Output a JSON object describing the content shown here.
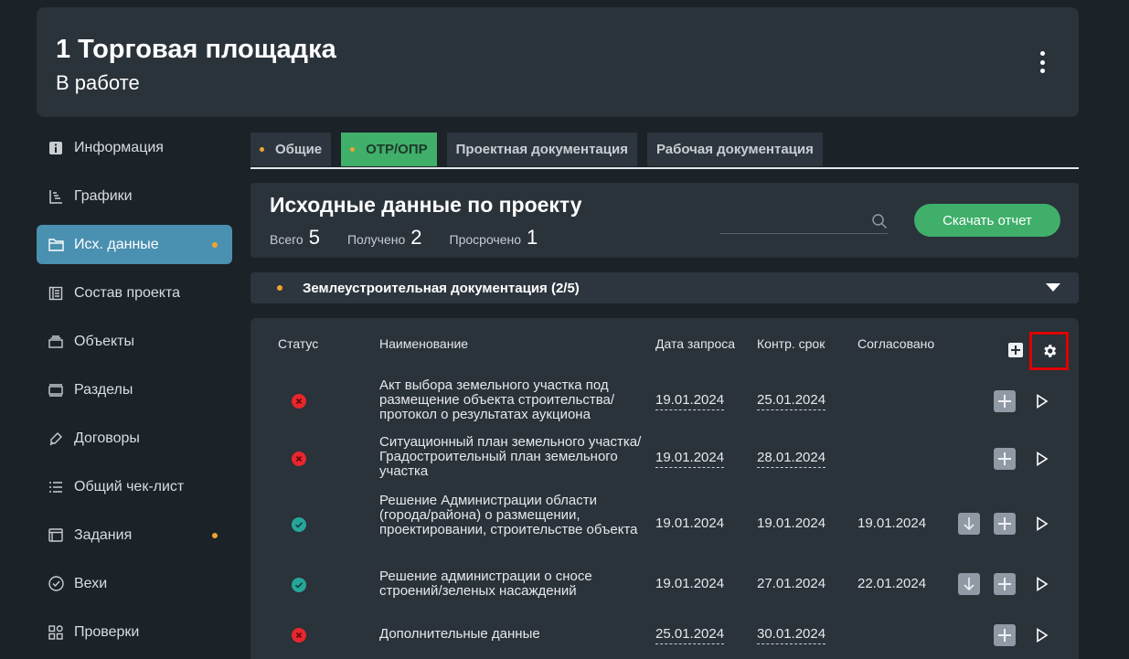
{
  "header": {
    "title": "1 Торговая площадка",
    "status": "В работе",
    "menu_icon": "kebab-menu-icon"
  },
  "sidebar": {
    "items": [
      {
        "label": "Информация",
        "icon": "info-icon",
        "active": false,
        "dot": false
      },
      {
        "label": "Графики",
        "icon": "gantt-icon",
        "active": false,
        "dot": false
      },
      {
        "label": "Исх. данные",
        "icon": "folder-icon",
        "active": true,
        "dot": true
      },
      {
        "label": "Состав проекта",
        "icon": "document-list-icon",
        "active": false,
        "dot": false
      },
      {
        "label": "Объекты",
        "icon": "stack-icon",
        "active": false,
        "dot": false
      },
      {
        "label": "Разделы",
        "icon": "sections-icon",
        "active": false,
        "dot": false
      },
      {
        "label": "Договоры",
        "icon": "pen-icon",
        "active": false,
        "dot": false
      },
      {
        "label": "Общий чек-лист",
        "icon": "checklist-icon",
        "active": false,
        "dot": false
      },
      {
        "label": "Задания",
        "icon": "tasks-icon",
        "active": false,
        "dot": true
      },
      {
        "label": "Вехи",
        "icon": "check-circle-icon",
        "active": false,
        "dot": false
      },
      {
        "label": "Проверки",
        "icon": "grid-icon",
        "active": false,
        "dot": false
      }
    ]
  },
  "tabs": [
    {
      "label": "Общие",
      "dot": true,
      "active": false
    },
    {
      "label": "ОТР/ОПР",
      "dot": true,
      "active": true
    },
    {
      "label": "Проектная документация",
      "dot": false,
      "active": false
    },
    {
      "label": "Рабочая документация",
      "dot": false,
      "active": false
    }
  ],
  "summary": {
    "title": "Исходные данные по проекту",
    "total_label": "Всего",
    "total_value": "5",
    "received_label": "Получено",
    "received_value": "2",
    "overdue_label": "Просрочено",
    "overdue_value": "1",
    "search_value": "",
    "download_label": "Скачать отчет"
  },
  "section": {
    "title": "Землеустроительная документация (2/5)"
  },
  "table": {
    "columns": {
      "status": "Статус",
      "name": "Наименование",
      "request_date": "Дата запроса",
      "deadline": "Контр. срок",
      "approved": "Согласовано"
    },
    "rows": [
      {
        "status": "error",
        "name": "Акт выбора земельного участка под размещение объекта строительства/протокол о результатах аукциона",
        "request_date": "19.01.2024",
        "deadline": "25.01.2024",
        "approved": "",
        "has_download": false
      },
      {
        "status": "error",
        "name": "Ситуационный план земельного участка/Градостроительный план земельного участка",
        "request_date": "19.01.2024",
        "deadline": "28.01.2024",
        "approved": "",
        "has_download": false
      },
      {
        "status": "ok",
        "name": "Решение Администрации области (города/района) о размещении, проектировании, строительстве объекта",
        "request_date": "19.01.2024",
        "deadline": "19.01.2024",
        "approved": "19.01.2024",
        "has_download": true
      },
      {
        "status": "ok",
        "name": "Решение администрации о сносе строений/зеленых насаждений",
        "request_date": "19.01.2024",
        "deadline": "27.01.2024",
        "approved": "22.01.2024",
        "has_download": true
      },
      {
        "status": "error",
        "name": "Дополнительные данные",
        "request_date": "25.01.2024",
        "deadline": "30.01.2024",
        "approved": "",
        "has_download": false
      }
    ]
  },
  "colors": {
    "background": "#1b2228",
    "card": "#2a323a",
    "accent_green": "#3faf6a",
    "active_blue": "#4a90b0",
    "dot_orange": "#f0a430",
    "status_error": "#e8262b",
    "status_ok": "#26a69a",
    "highlight_red": "#e00000"
  }
}
